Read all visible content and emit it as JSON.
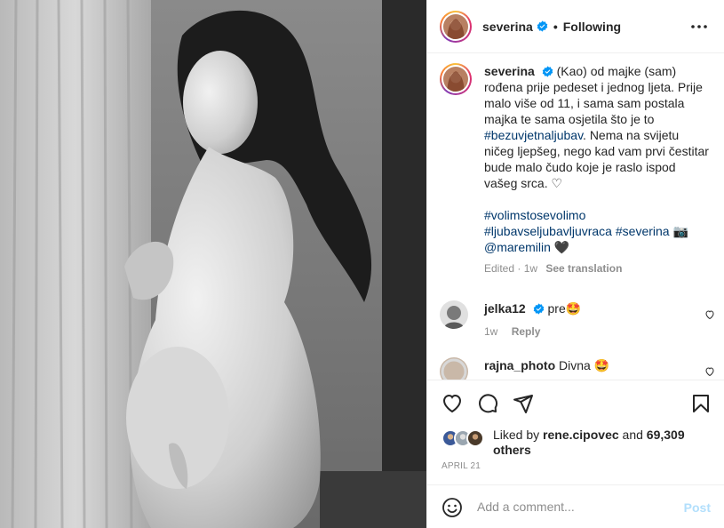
{
  "post": {
    "username": "severina",
    "follow_state": "Following",
    "dot": "•",
    "image_alt": "black and white portrait photo"
  },
  "caption": {
    "username": "severina",
    "text_1": "(Kao) od majke (sam) rođena prije pedeset i jednog ljeta. Prije malo više od 11, i sama sam postala majka te sama osjetila što je to ",
    "hashtag_1": "#bezuvjetnaljubav",
    "text_2": ". Nema na svijetu ničeg ljepšeg, nego kad vam prvi čestitar bude malo čudo koje je raslo ispod vašeg srca. ♡",
    "hashtag_2": "#volimstosevolimo",
    "hashtag_3": "#ljubavseljubavljuvraca",
    "hashtag_4": "#severina",
    "camera_emoji": "📷",
    "mention": "@maremilin",
    "heart_emoji": "🖤",
    "meta_edited": "Edited · 1w",
    "meta_translate": "See translation"
  },
  "comments": [
    {
      "username": "jelka12",
      "text": "pre🤩",
      "time": "1w",
      "reply": "Reply"
    },
    {
      "username": "rajna_photo",
      "text": "Divna 🤩"
    }
  ],
  "likes": {
    "prefix": "Liked by ",
    "user": "rene.cipovec",
    "middle": " and ",
    "count": "69,309",
    "suffix": "others"
  },
  "date": "APRIL 21",
  "composer": {
    "placeholder": "Add a comment...",
    "post_label": "Post"
  },
  "colors": {
    "link": "#00376b",
    "muted": "#8e8e8e",
    "verified": "#0095f6",
    "post_disabled": "#b2dffc"
  },
  "icons": [
    "verified-badge-icon",
    "more-options-icon",
    "heart-icon",
    "comment-icon",
    "share-icon",
    "bookmark-icon",
    "emoji-icon"
  ]
}
